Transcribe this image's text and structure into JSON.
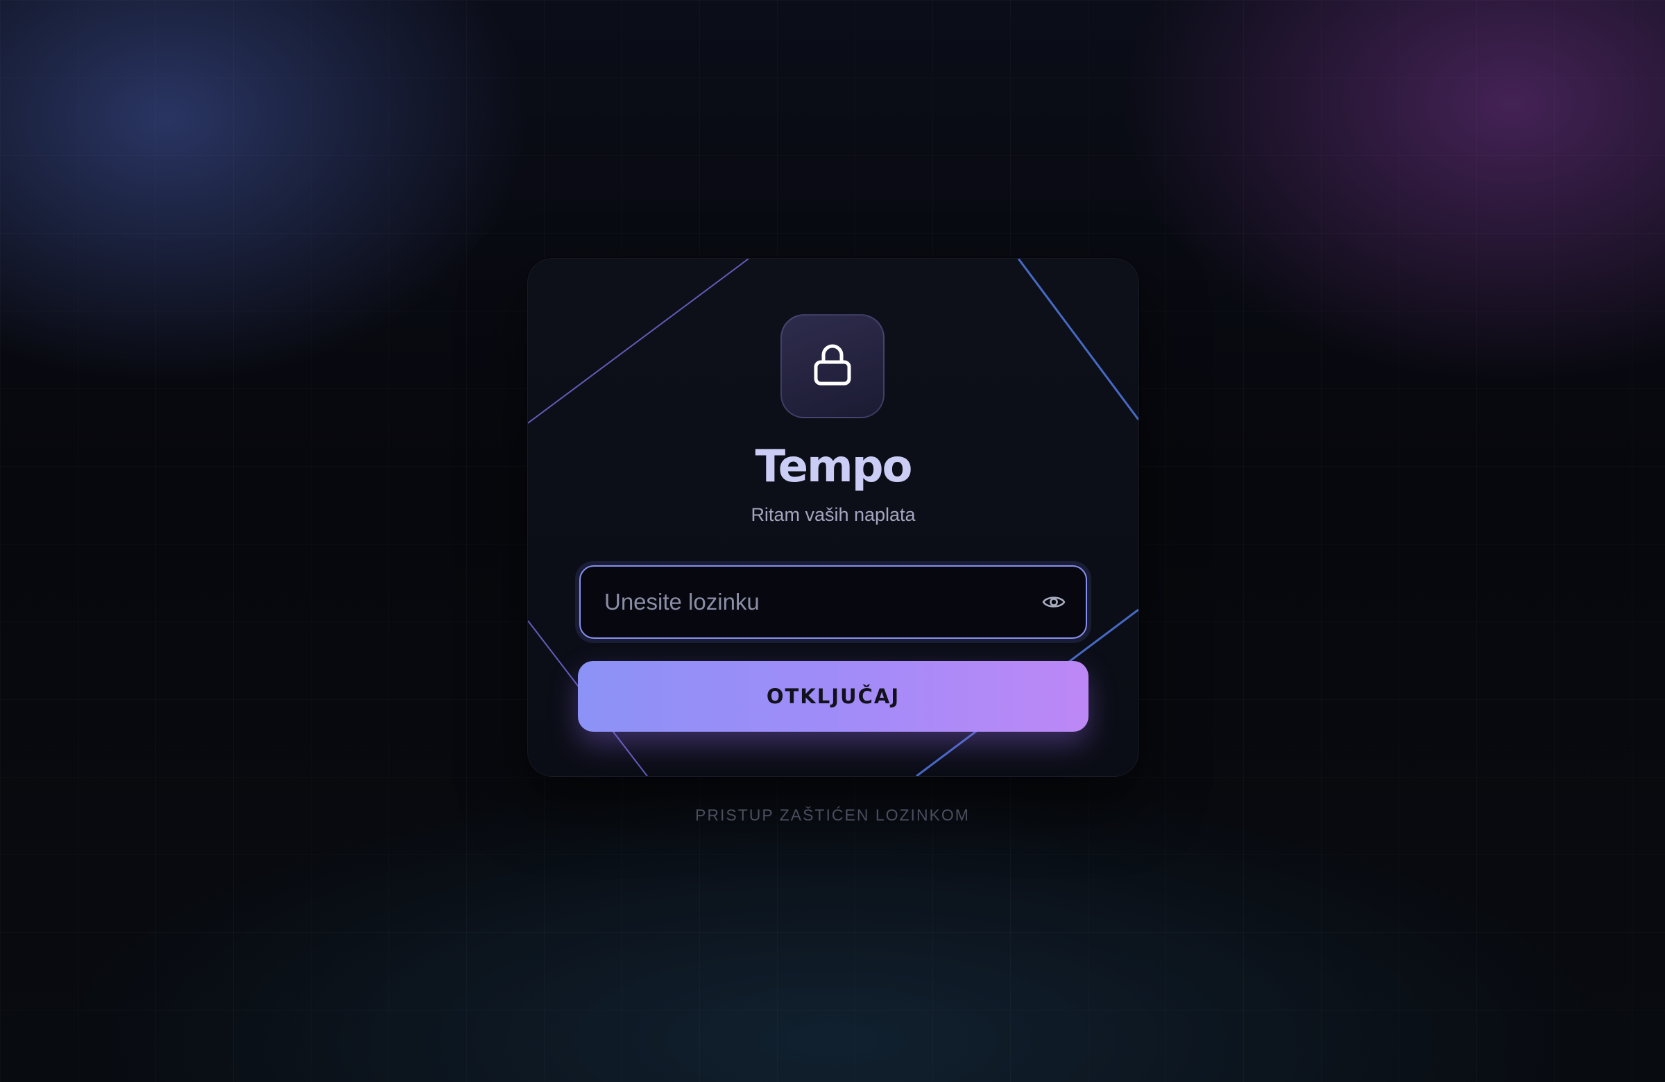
{
  "app": {
    "name": "Tempo",
    "tagline": "Ritam vaših naplata"
  },
  "password": {
    "value": "",
    "placeholder": "Unesite lozinku",
    "toggle_icon": "eye-icon"
  },
  "unlock_button": {
    "label": "OTKLJUČAJ"
  },
  "footer": {
    "note": "PRISTUP ZAŠTIĆEN LOZINKOM"
  },
  "icons": {
    "lock": "lock-icon",
    "eye": "eye-icon"
  },
  "colors": {
    "accent_start": "#8c92f6",
    "accent_end": "#bd88f6",
    "brand_text": "#cbcdf5",
    "field_border": "#8a8ff0"
  }
}
